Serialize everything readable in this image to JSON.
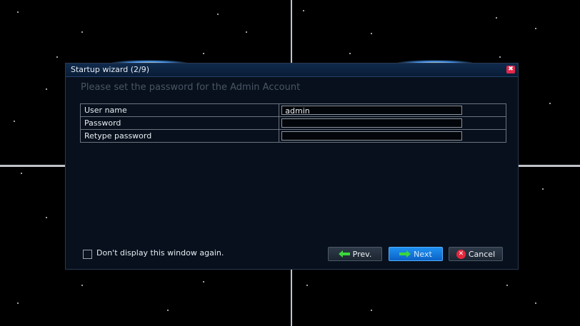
{
  "dialog": {
    "title": "Startup wizard (2/9)",
    "subtitle": "Please set the password for the Admin Account",
    "fields": [
      {
        "label": "User name",
        "value": "admin"
      },
      {
        "label": "Password",
        "value": ""
      },
      {
        "label": "Retype password",
        "value": ""
      }
    ],
    "dont_display_label": "Don't display this window again.",
    "dont_display_checked": false,
    "buttons": {
      "prev": "Prev.",
      "next": "Next",
      "cancel": "Cancel"
    }
  },
  "icons": {
    "close": "close-icon",
    "prev": "left-arrow-icon",
    "next": "right-arrow-icon",
    "cancel": "cancel-x-icon"
  },
  "colors": {
    "accent": "#1f90f0",
    "close": "#e2294a",
    "arrow": "#3cd63c"
  }
}
